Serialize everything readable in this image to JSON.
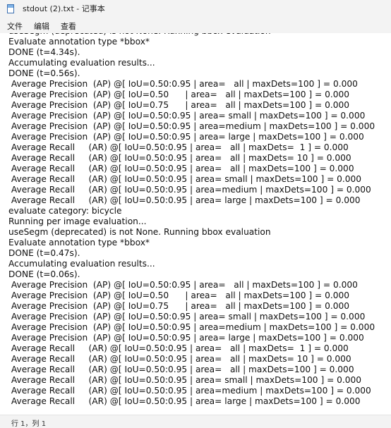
{
  "window": {
    "title": "stdout (2).txt - 记事本",
    "icon": "notepad-icon"
  },
  "menu": {
    "items": [
      "文件",
      "编辑",
      "查看"
    ]
  },
  "editor": {
    "lines": [
      "useSegm (deprecated) is not None. Running bbox evaluation",
      "Evaluate annotation type *bbox*",
      "DONE (t=4.34s).",
      "Accumulating evaluation results...",
      "DONE (t=0.56s).",
      " Average Precision  (AP) @[ IoU=0.50:0.95 | area=   all | maxDets=100 ] = 0.000",
      " Average Precision  (AP) @[ IoU=0.50      | area=   all | maxDets=100 ] = 0.000",
      " Average Precision  (AP) @[ IoU=0.75      | area=   all | maxDets=100 ] = 0.000",
      " Average Precision  (AP) @[ IoU=0.50:0.95 | area= small | maxDets=100 ] = 0.000",
      " Average Precision  (AP) @[ IoU=0.50:0.95 | area=medium | maxDets=100 ] = 0.000",
      " Average Precision  (AP) @[ IoU=0.50:0.95 | area= large | maxDets=100 ] = 0.000",
      " Average Recall     (AR) @[ IoU=0.50:0.95 | area=   all | maxDets=  1 ] = 0.000",
      " Average Recall     (AR) @[ IoU=0.50:0.95 | area=   all | maxDets= 10 ] = 0.000",
      " Average Recall     (AR) @[ IoU=0.50:0.95 | area=   all | maxDets=100 ] = 0.000",
      " Average Recall     (AR) @[ IoU=0.50:0.95 | area= small | maxDets=100 ] = 0.000",
      " Average Recall     (AR) @[ IoU=0.50:0.95 | area=medium | maxDets=100 ] = 0.000",
      " Average Recall     (AR) @[ IoU=0.50:0.95 | area= large | maxDets=100 ] = 0.000",
      "evaluate category: bicycle",
      "Running per image evaluation...",
      "useSegm (deprecated) is not None. Running bbox evaluation",
      "Evaluate annotation type *bbox*",
      "DONE (t=0.47s).",
      "Accumulating evaluation results...",
      "DONE (t=0.06s).",
      " Average Precision  (AP) @[ IoU=0.50:0.95 | area=   all | maxDets=100 ] = 0.000",
      " Average Precision  (AP) @[ IoU=0.50      | area=   all | maxDets=100 ] = 0.000",
      " Average Precision  (AP) @[ IoU=0.75      | area=   all | maxDets=100 ] = 0.000",
      " Average Precision  (AP) @[ IoU=0.50:0.95 | area= small | maxDets=100 ] = 0.000",
      " Average Precision  (AP) @[ IoU=0.50:0.95 | area=medium | maxDets=100 ] = 0.000",
      " Average Precision  (AP) @[ IoU=0.50:0.95 | area= large | maxDets=100 ] = 0.000",
      " Average Recall     (AR) @[ IoU=0.50:0.95 | area=   all | maxDets=  1 ] = 0.000",
      " Average Recall     (AR) @[ IoU=0.50:0.95 | area=   all | maxDets= 10 ] = 0.000",
      " Average Recall     (AR) @[ IoU=0.50:0.95 | area=   all | maxDets=100 ] = 0.000",
      " Average Recall     (AR) @[ IoU=0.50:0.95 | area= small | maxDets=100 ] = 0.000",
      " Average Recall     (AR) @[ IoU=0.50:0.95 | area=medium | maxDets=100 ] = 0.000",
      " Average Recall     (AR) @[ IoU=0.50:0.95 | area= large | maxDets=100 ] = 0.000"
    ]
  },
  "status": {
    "position": "行 1，列 1"
  }
}
